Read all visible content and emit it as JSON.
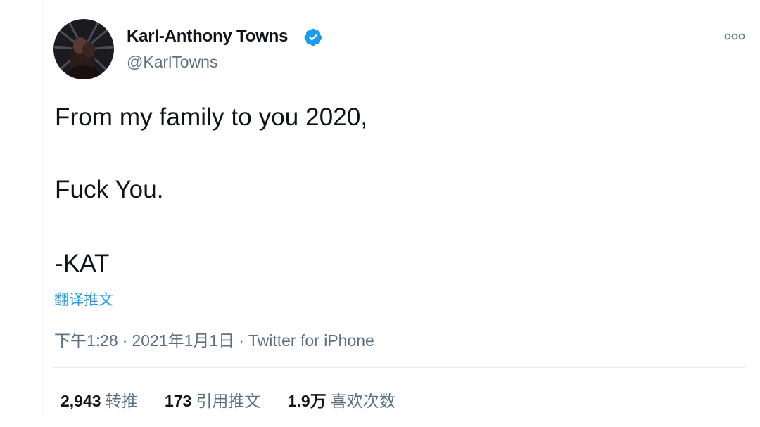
{
  "author": {
    "display_name": "Karl-Anthony Towns",
    "handle": "@KarlTowns",
    "verified": true
  },
  "tweet": {
    "lines": [
      "From my family to you 2020,",
      "Fuck You.",
      "-KAT"
    ],
    "translate_label": "翻译推文",
    "time": "下午1:28",
    "separator": "·",
    "date": "2021年1月1日",
    "source": "Twitter for iPhone"
  },
  "stats": {
    "retweets": {
      "count": "2,943",
      "label": "转推"
    },
    "quotes": {
      "count": "173",
      "label": "引用推文"
    },
    "likes": {
      "count": "1.9万",
      "label": "喜欢次数"
    }
  },
  "icons": {
    "more": "more-options-icon",
    "verified": "verified-badge-icon"
  },
  "colors": {
    "accent": "#1d9bf0",
    "text_primary": "#0f1419",
    "text_secondary": "#5b7083",
    "divider": "#e6ecf0"
  }
}
